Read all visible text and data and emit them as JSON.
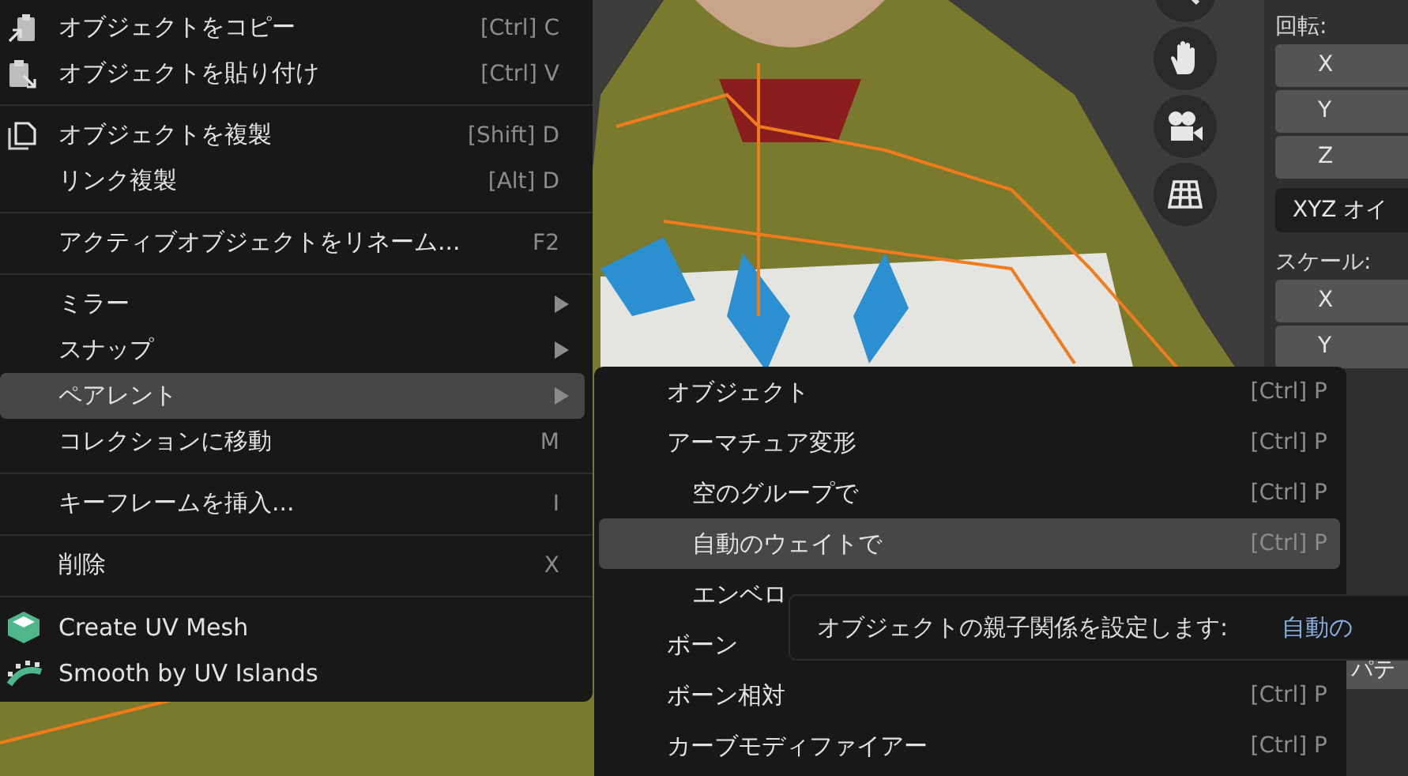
{
  "properties_panel": {
    "rotation_label": "回転:",
    "rotation_axes": [
      "X",
      "Y",
      "Z"
    ],
    "rotation_mode": "XYZ オイ",
    "scale_label": "スケール:",
    "scale_axes": [
      "X",
      "Y"
    ],
    "cut_field": "パテ"
  },
  "context_menu": {
    "items": [
      {
        "kind": "item",
        "label": "オブジェクトをコピー",
        "shortcut": "[Ctrl] C",
        "selected": false
      },
      {
        "kind": "item",
        "label": "オブジェクトを貼り付け",
        "shortcut": "[Ctrl] V",
        "selected": false
      },
      {
        "kind": "separator"
      },
      {
        "kind": "item",
        "label": "オブジェクトを複製",
        "shortcut": "[Shift] D",
        "selected": false
      },
      {
        "kind": "item",
        "label": "リンク複製",
        "shortcut": "[Alt] D",
        "selected": false
      },
      {
        "kind": "separator"
      },
      {
        "kind": "item",
        "label": "アクティブオブジェクトをリネーム...",
        "shortcut": "F2",
        "selected": false
      },
      {
        "kind": "separator"
      },
      {
        "kind": "submenu",
        "label": "ミラー",
        "selected": false
      },
      {
        "kind": "submenu",
        "label": "スナップ",
        "selected": false
      },
      {
        "kind": "submenu",
        "label": "ペアレント",
        "selected": true
      },
      {
        "kind": "item",
        "label": "コレクションに移動",
        "shortcut": "M",
        "selected": false
      },
      {
        "kind": "separator"
      },
      {
        "kind": "item",
        "label": "キーフレームを挿入...",
        "shortcut": "I",
        "selected": false
      },
      {
        "kind": "separator"
      },
      {
        "kind": "item",
        "label": "削除",
        "shortcut": "X",
        "selected": false
      },
      {
        "kind": "separator"
      },
      {
        "kind": "item",
        "label": "Create UV Mesh",
        "selected": false
      },
      {
        "kind": "item",
        "label": "Smooth by UV Islands",
        "selected": false
      }
    ]
  },
  "parent_submenu": {
    "items": [
      {
        "label": "オブジェクト",
        "shortcut": "[Ctrl] P",
        "selected": false
      },
      {
        "label": "アーマチュア変形",
        "shortcut": "[Ctrl] P",
        "selected": false,
        "children": [
          {
            "label": "空のグループで",
            "shortcut": "[Ctrl] P",
            "selected": false
          },
          {
            "label": "自動のウェイトで",
            "shortcut": "[Ctrl] P",
            "selected": true
          },
          {
            "label": "エンベロ",
            "selected": false
          }
        ]
      },
      {
        "label": "ボーン",
        "selected": false
      },
      {
        "label": "ボーン相対",
        "shortcut": "[Ctrl] P",
        "selected": false
      },
      {
        "label": "カーブモディファイアー",
        "shortcut": "[Ctrl] P",
        "selected": false
      }
    ]
  },
  "tooltip": {
    "text": "オブジェクトの親子関係を設定します:",
    "value": "自動の"
  }
}
